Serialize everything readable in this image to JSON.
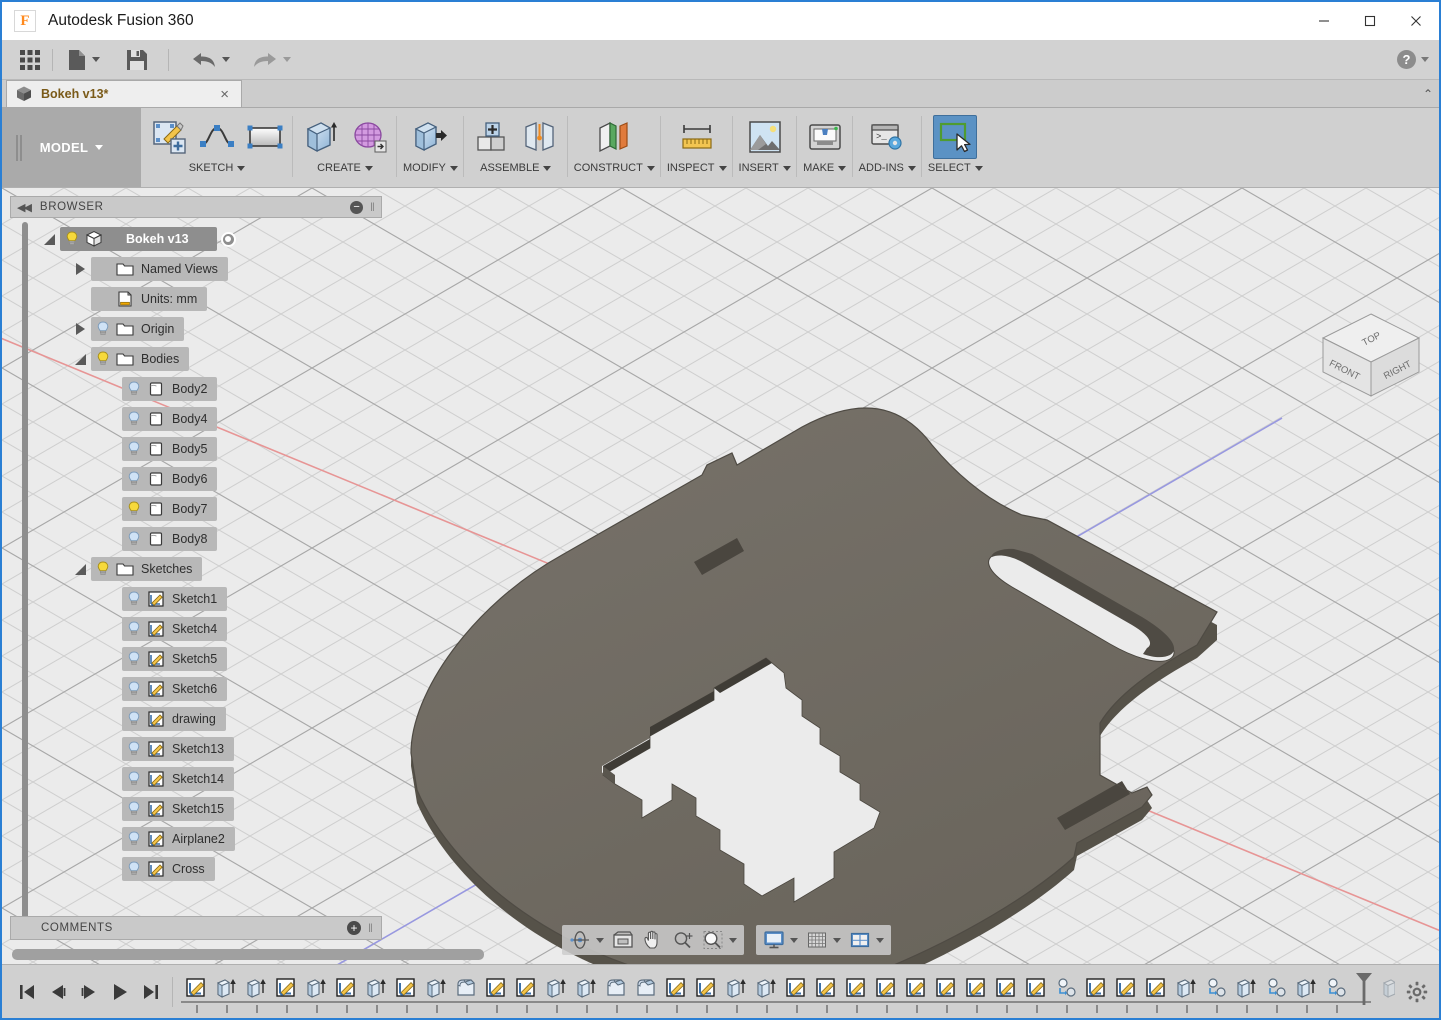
{
  "window": {
    "title": "Autodesk Fusion 360",
    "logo_glyph": "F",
    "minimize": "minimize-icon",
    "maximize": "maximize-icon",
    "close": "close-icon"
  },
  "quick_access": {
    "items": [
      {
        "name": "app-grid-icon",
        "label": "",
        "has_caret": false
      },
      {
        "name": "new-document-icon",
        "label": "",
        "has_caret": true
      },
      {
        "name": "save-icon",
        "label": "",
        "has_caret": false
      },
      {
        "name": "undo-icon",
        "label": "",
        "has_caret": true
      },
      {
        "name": "redo-icon",
        "label": "",
        "has_caret": true
      }
    ],
    "help_label": "?"
  },
  "tabs": {
    "documents": [
      {
        "label": "Bokeh v13*",
        "close": "×",
        "active": true
      }
    ],
    "expand_glyph": "⌃"
  },
  "ribbon": {
    "workspace": {
      "label": "MODEL"
    },
    "groups": [
      {
        "label": "SKETCH",
        "caret": true,
        "buttons": [
          {
            "name": "create-sketch-icon"
          },
          {
            "name": "spline-icon"
          },
          {
            "name": "rectangle-icon"
          }
        ]
      },
      {
        "label": "CREATE",
        "caret": true,
        "buttons": [
          {
            "name": "extrude-icon"
          },
          {
            "name": "create-form-icon"
          }
        ]
      },
      {
        "label": "MODIFY",
        "caret": true,
        "buttons": [
          {
            "name": "press-pull-icon"
          }
        ]
      },
      {
        "label": "ASSEMBLE",
        "caret": true,
        "buttons": [
          {
            "name": "new-component-icon"
          },
          {
            "name": "joint-icon"
          }
        ]
      },
      {
        "label": "CONSTRUCT",
        "caret": true,
        "buttons": [
          {
            "name": "offset-plane-icon"
          }
        ]
      },
      {
        "label": "INSPECT",
        "caret": true,
        "buttons": [
          {
            "name": "measure-icon"
          }
        ]
      },
      {
        "label": "INSERT",
        "caret": true,
        "buttons": [
          {
            "name": "insert-image-icon"
          }
        ]
      },
      {
        "label": "MAKE",
        "caret": true,
        "buttons": [
          {
            "name": "3d-print-icon"
          }
        ]
      },
      {
        "label": "ADD-INS",
        "caret": true,
        "buttons": [
          {
            "name": "scripts-addins-icon"
          }
        ]
      },
      {
        "label": "SELECT",
        "caret": true,
        "active": true,
        "buttons": [
          {
            "name": "select-window-icon"
          }
        ]
      }
    ]
  },
  "viewcube": {
    "faces": {
      "top": "TOP",
      "front": "FRONT",
      "right": "RIGHT"
    }
  },
  "browser": {
    "header": {
      "title": "BROWSER",
      "collapse": "◀◀",
      "minus": "−",
      "grip": "‖"
    },
    "tree": [
      {
        "label": "Bokeh v13",
        "indent": 0,
        "twisty": "open",
        "bulb": "on",
        "icon": "component-icon",
        "selected": true,
        "radio": true
      },
      {
        "label": "Named Views",
        "indent": 1,
        "twisty": "closed",
        "bulb": "none",
        "icon": "folder-icon"
      },
      {
        "label": "Units: mm",
        "indent": 1,
        "twisty": "none",
        "bulb": "none",
        "icon": "units-icon"
      },
      {
        "label": "Origin",
        "indent": 1,
        "twisty": "closed",
        "bulb": "off",
        "icon": "folder-icon"
      },
      {
        "label": "Bodies",
        "indent": 1,
        "twisty": "open",
        "bulb": "on",
        "icon": "folder-icon"
      },
      {
        "label": "Body2",
        "indent": 2,
        "twisty": "none",
        "bulb": "off",
        "icon": "body-icon"
      },
      {
        "label": "Body4",
        "indent": 2,
        "twisty": "none",
        "bulb": "off",
        "icon": "body-icon"
      },
      {
        "label": "Body5",
        "indent": 2,
        "twisty": "none",
        "bulb": "off",
        "icon": "body-icon"
      },
      {
        "label": "Body6",
        "indent": 2,
        "twisty": "none",
        "bulb": "off",
        "icon": "body-icon"
      },
      {
        "label": "Body7",
        "indent": 2,
        "twisty": "none",
        "bulb": "on",
        "icon": "body-icon"
      },
      {
        "label": "Body8",
        "indent": 2,
        "twisty": "none",
        "bulb": "off",
        "icon": "body-icon"
      },
      {
        "label": "Sketches",
        "indent": 1,
        "twisty": "open",
        "bulb": "on",
        "icon": "folder-icon"
      },
      {
        "label": "Sketch1",
        "indent": 2,
        "twisty": "none",
        "bulb": "off",
        "icon": "sketch-icon"
      },
      {
        "label": "Sketch4",
        "indent": 2,
        "twisty": "none",
        "bulb": "off",
        "icon": "sketch-icon"
      },
      {
        "label": "Sketch5",
        "indent": 2,
        "twisty": "none",
        "bulb": "off",
        "icon": "sketch-icon"
      },
      {
        "label": "Sketch6",
        "indent": 2,
        "twisty": "none",
        "bulb": "off",
        "icon": "sketch-icon"
      },
      {
        "label": "drawing",
        "indent": 2,
        "twisty": "none",
        "bulb": "off",
        "icon": "sketch-icon"
      },
      {
        "label": "Sketch13",
        "indent": 2,
        "twisty": "none",
        "bulb": "off",
        "icon": "sketch-icon"
      },
      {
        "label": "Sketch14",
        "indent": 2,
        "twisty": "none",
        "bulb": "off",
        "icon": "sketch-icon"
      },
      {
        "label": "Sketch15",
        "indent": 2,
        "twisty": "none",
        "bulb": "off",
        "icon": "sketch-icon"
      },
      {
        "label": "Airplane2",
        "indent": 2,
        "twisty": "none",
        "bulb": "off",
        "icon": "sketch-icon"
      },
      {
        "label": "Cross",
        "indent": 2,
        "twisty": "none",
        "bulb": "off",
        "icon": "sketch-icon"
      }
    ]
  },
  "comments": {
    "title": "COMMENTS",
    "add": "+"
  },
  "navigation_bar": {
    "group1": [
      {
        "name": "orbit-icon",
        "caret": true
      },
      {
        "name": "look-at-icon",
        "caret": false
      },
      {
        "name": "pan-icon",
        "caret": false
      },
      {
        "name": "zoom-icon",
        "caret": false
      },
      {
        "name": "fit-icon",
        "caret": true
      }
    ],
    "group2": [
      {
        "name": "display-settings-icon",
        "caret": true
      },
      {
        "name": "grid-snaps-icon",
        "caret": true
      },
      {
        "name": "viewports-icon",
        "caret": true
      }
    ]
  },
  "timeline": {
    "playback": [
      {
        "name": "go-to-beginning-button",
        "glyph": "skip-back"
      },
      {
        "name": "step-back-button",
        "glyph": "step-back"
      },
      {
        "name": "step-forward-button",
        "glyph": "step-forward"
      },
      {
        "name": "play-button",
        "glyph": "play"
      },
      {
        "name": "go-to-end-button",
        "glyph": "skip-forward"
      }
    ],
    "features": [
      "sketch",
      "extrude",
      "extrude",
      "sketch",
      "extrude",
      "sketch",
      "extrude",
      "sketch",
      "extrude",
      "fillet",
      "sketch",
      "sketch",
      "extrude",
      "extrude",
      "fillet",
      "fillet",
      "sketch",
      "sketch",
      "extrude",
      "extrude",
      "sketch",
      "sketch",
      "sketch",
      "sketch",
      "sketch",
      "sketch",
      "sketch",
      "sketch",
      "sketch",
      "move",
      "sketch",
      "sketch",
      "sketch",
      "extrude",
      "move",
      "extrude",
      "move",
      "extrude",
      "move"
    ],
    "end_marker": "timeline-end-marker",
    "settings": "timeline-settings-icon"
  },
  "model": {
    "body_color": "#6f6a60",
    "body_color_dark": "#4f4b44",
    "body_color_mid": "#5c584f",
    "axis_x_color": "#e88a8a",
    "axis_y_color": "#8a8ae8",
    "grid_color": "#c9c9c9",
    "canvas_bg": "#ebebeb"
  }
}
